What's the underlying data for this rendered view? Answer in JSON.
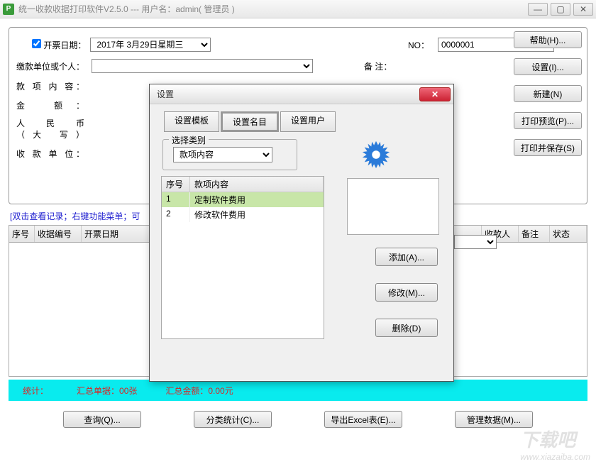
{
  "app": {
    "icon_letter": "P",
    "title": "统一收款收据打印软件V2.5.0 --- 用户名：admin( 管理员 )"
  },
  "form": {
    "date_checkbox_label": "开票日期：",
    "date_value": "2017年 3月29日星期三",
    "no_label": "NO：",
    "no_value": "0000001",
    "payer_label": "缴款单位或个人：",
    "remark_label": "备 注：",
    "content_label": "款 项 内 容：",
    "amount_label": "金      额：",
    "rmb_label_1": "人  民  币",
    "rmb_label_2": "（大  写）",
    "payee_unit_label": "收 款 单 位："
  },
  "side_buttons": {
    "help": "帮助(H)...",
    "settings": "设置(I)...",
    "new": "新建(N)",
    "preview": "打印预览(P)...",
    "print_save": "打印并保存(S)"
  },
  "hint": "[双击查看记录；右键功能菜单；可",
  "rec_headers": [
    "序号",
    "收据编号",
    "开票日期",
    "收款人",
    "备注",
    "状态"
  ],
  "stats": {
    "label": "统计：",
    "count": "汇总单据：00张",
    "amount": "汇总金额：0.00元"
  },
  "bottom": {
    "query": "查询(Q)...",
    "cat_stats": "分类统计(C)...",
    "export": "导出Excel表(E)...",
    "manage": "管理数据(M)..."
  },
  "dialog": {
    "title": "设置",
    "tabs": {
      "tpl": "设置模板",
      "name": "设置名目",
      "user": "设置用户"
    },
    "cat_legend": "选择类别",
    "cat_value": "款项内容",
    "items_head_n": "序号",
    "items_head_v": "款项内容",
    "items": [
      {
        "n": "1",
        "v": "定制软件费用"
      },
      {
        "n": "2",
        "v": "修改软件费用"
      }
    ],
    "btns": {
      "add": "添加(A)...",
      "modify": "修改(M)...",
      "delete": "删除(D)"
    }
  },
  "watermark": {
    "big": "下载吧",
    "small": "www.xiazaiba.com"
  }
}
